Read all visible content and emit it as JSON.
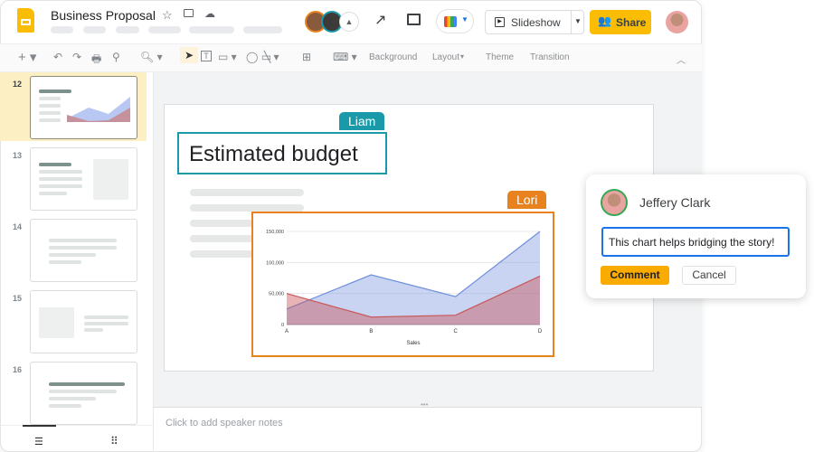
{
  "header": {
    "title": "Business Proposal",
    "icons": [
      "star-icon",
      "move-to-folder-icon",
      "cloud-saved-icon"
    ],
    "slideshow_label": "Slideshow",
    "share_label": "Share",
    "accent": "#fbbc04"
  },
  "toolbar": {
    "background": "Background",
    "layout": "Layout",
    "theme": "Theme",
    "transition": "Transition"
  },
  "filmstrip": {
    "slides": [
      "12",
      "13",
      "14",
      "15",
      "16"
    ],
    "selected": "12"
  },
  "slide": {
    "title": "Estimated budget",
    "collaborators": [
      {
        "name": "Liam",
        "color": "#1a9aa8"
      },
      {
        "name": "Lori",
        "color": "#e8821e"
      }
    ]
  },
  "notes": {
    "placeholder": "Click to add speaker notes"
  },
  "comment": {
    "author": "Jeffery Clark",
    "text": "This chart helps bridging the story!",
    "submit": "Comment",
    "cancel": "Cancel"
  },
  "chart_data": {
    "type": "area",
    "categories": [
      "A",
      "B",
      "C",
      "D"
    ],
    "xlabel": "Sales",
    "ylabel": "",
    "ylim": [
      0,
      150000
    ],
    "yticks": [
      "0",
      "50,000",
      "100,000",
      "150,000"
    ],
    "grid": true,
    "series": [
      {
        "values": [
          25000,
          80000,
          45000,
          150000
        ],
        "color": "#6f8fdc"
      },
      {
        "values": [
          50000,
          12000,
          15000,
          78000
        ],
        "color": "#c9575a"
      }
    ]
  }
}
